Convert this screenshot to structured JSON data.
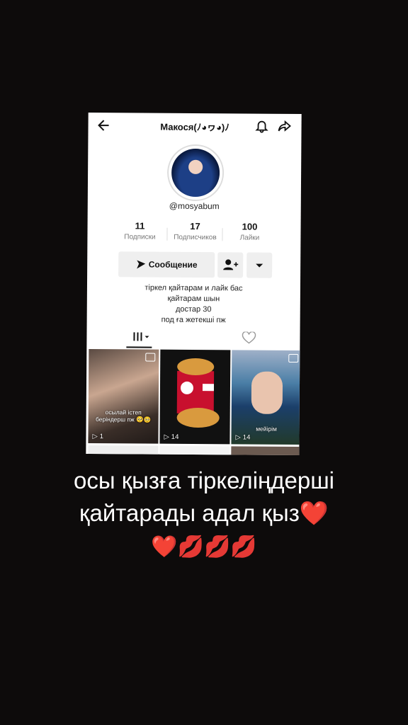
{
  "profile": {
    "title": "Макося(ﾉ◕ヮ◕)ﾉ",
    "handle": "@mosyabum",
    "stats": [
      {
        "value": "11",
        "label": "Подписки"
      },
      {
        "value": "17",
        "label": "Подписчиков"
      },
      {
        "value": "100",
        "label": "Лайки"
      }
    ],
    "message_button": "Сообщение",
    "bio": [
      "тіркел қайтарам и лайк бас",
      "қайтарам шын",
      "достар 30",
      "под ға жетекші пж"
    ]
  },
  "videos": [
    {
      "caption": "осылай істеп беріндерш пж 🥺🥺",
      "count": "1"
    },
    {
      "caption": "",
      "count": "14"
    },
    {
      "caption": "мейірім",
      "count": "14"
    }
  ],
  "overlay_text": {
    "line1": "осы қызға тіркеліңдерші",
    "line2": "қайтарады адал қыз❤️",
    "line3": "❤️💋💋💋"
  },
  "icons": [
    "back-arrow",
    "bell",
    "share-arrow",
    "send",
    "add-friend",
    "caret-down",
    "grid",
    "heart-lock",
    "play",
    "photo"
  ]
}
